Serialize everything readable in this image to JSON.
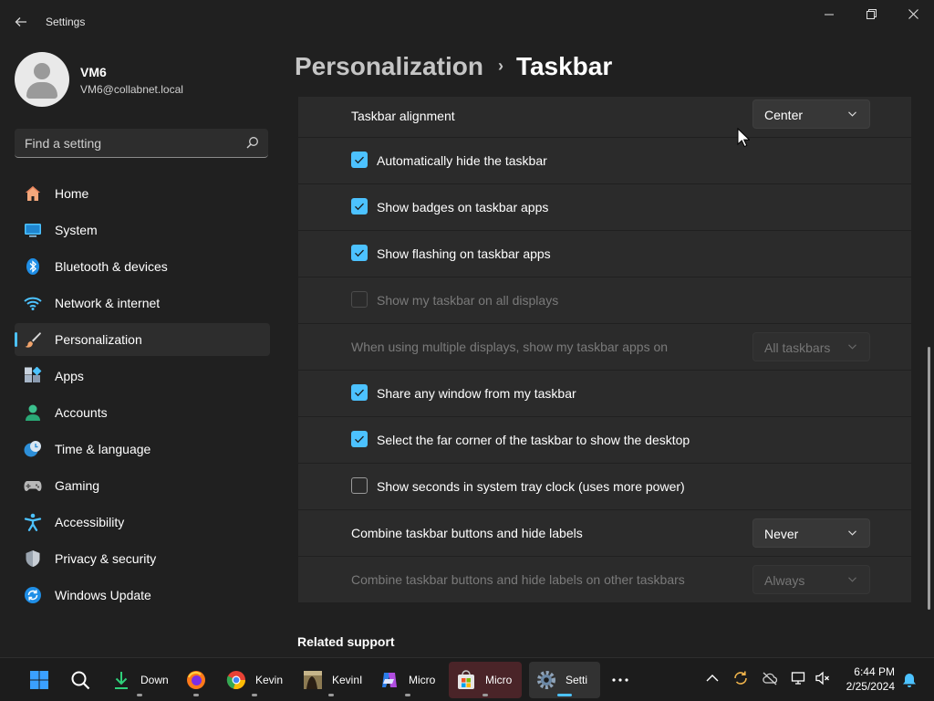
{
  "window": {
    "app_title": "Settings",
    "back_icon": "arrow-left-icon",
    "minimize_glyph": "—",
    "maximize_glyph": "❐",
    "close_glyph": "✕"
  },
  "profile": {
    "name": "VM6",
    "email": "VM6@collabnet.local"
  },
  "search": {
    "placeholder": "Find a setting",
    "value": ""
  },
  "sidebar": {
    "items": [
      {
        "label": "Home",
        "icon": "home-icon",
        "active": false
      },
      {
        "label": "System",
        "icon": "monitor-icon",
        "active": false
      },
      {
        "label": "Bluetooth & devices",
        "icon": "bluetooth-icon",
        "active": false
      },
      {
        "label": "Network & internet",
        "icon": "wifi-icon",
        "active": false
      },
      {
        "label": "Personalization",
        "icon": "paintbrush-icon",
        "active": true
      },
      {
        "label": "Apps",
        "icon": "apps-icon",
        "active": false
      },
      {
        "label": "Accounts",
        "icon": "person-icon",
        "active": false
      },
      {
        "label": "Time & language",
        "icon": "clock-globe-icon",
        "active": false
      },
      {
        "label": "Gaming",
        "icon": "gamepad-icon",
        "active": false
      },
      {
        "label": "Accessibility",
        "icon": "accessibility-icon",
        "active": false
      },
      {
        "label": "Privacy & security",
        "icon": "shield-icon",
        "active": false
      },
      {
        "label": "Windows Update",
        "icon": "update-icon",
        "active": false
      }
    ]
  },
  "breadcrumb": {
    "parent": "Personalization",
    "separator": "›",
    "current": "Taskbar"
  },
  "settings": [
    {
      "kind": "dropdown",
      "label": "Taskbar alignment",
      "value": "Center",
      "enabled": true
    },
    {
      "kind": "checkbox",
      "label": "Automatically hide the taskbar",
      "checked": true,
      "enabled": true
    },
    {
      "kind": "checkbox",
      "label": "Show badges on taskbar apps",
      "checked": true,
      "enabled": true
    },
    {
      "kind": "checkbox",
      "label": "Show flashing on taskbar apps",
      "checked": true,
      "enabled": true
    },
    {
      "kind": "checkbox",
      "label": "Show my taskbar on all displays",
      "checked": false,
      "enabled": false
    },
    {
      "kind": "dropdown",
      "label": "When using multiple displays, show my taskbar apps on",
      "value": "All taskbars",
      "enabled": false
    },
    {
      "kind": "checkbox",
      "label": "Share any window from my taskbar",
      "checked": true,
      "enabled": true
    },
    {
      "kind": "checkbox",
      "label": "Select the far corner of the taskbar to show the desktop",
      "checked": true,
      "enabled": true
    },
    {
      "kind": "checkbox",
      "label": "Show seconds in system tray clock (uses more power)",
      "checked": false,
      "enabled": true
    },
    {
      "kind": "dropdown",
      "label": "Combine taskbar buttons and hide labels",
      "value": "Never",
      "enabled": true
    },
    {
      "kind": "dropdown",
      "label": "Combine taskbar buttons and hide labels on other taskbars",
      "value": "Always",
      "enabled": false
    }
  ],
  "related_support": "Related support",
  "taskbar": {
    "items": [
      {
        "icon": "windows-start-icon",
        "label": ""
      },
      {
        "icon": "search-icon",
        "label": ""
      },
      {
        "icon": "download-icon",
        "label": "Down"
      },
      {
        "icon": "firefox-icon",
        "label": ""
      },
      {
        "icon": "chrome-icon",
        "label": "Kevin"
      },
      {
        "icon": "image-thumbnail-icon",
        "label": "KevinI"
      },
      {
        "icon": "copilot-icon",
        "label": "Micro"
      },
      {
        "icon": "store-icon",
        "label": "Micro"
      },
      {
        "icon": "settings-gear-icon",
        "label": "Setti"
      },
      {
        "icon": "more-icon",
        "label": ""
      }
    ],
    "tray_icons": [
      "chevron-up-icon",
      "sync-icon",
      "cloud-icon",
      "network-icon",
      "volume-icon",
      "notification-bell-icon"
    ],
    "time": "6:44 PM",
    "date": "2/25/2024"
  },
  "colors": {
    "accent": "#4cc2ff",
    "background": "#202020",
    "card": "#2b2b2b"
  }
}
